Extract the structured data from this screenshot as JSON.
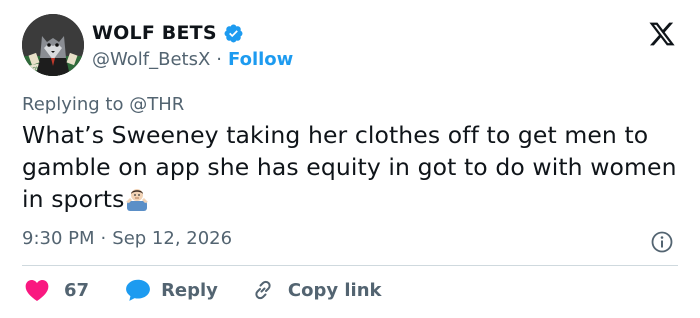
{
  "user": {
    "display_name": "WOLF BETS",
    "handle": "@Wolf_BetsX",
    "separator": "·",
    "follow_label": "Follow",
    "avatar_icon": "wolf-avatar",
    "verified_icon": "verified-badge-icon",
    "verified_color": "#1d9bf0"
  },
  "platform": {
    "logo_icon": "x-logo-icon"
  },
  "reply": {
    "prefix": "Replying to ",
    "target": "@THR"
  },
  "tweet": {
    "text": "What’s Sweeney taking her clothes off to get men to gamble on app she has equity in got to do with women in sports",
    "emoji": "man-shrugging-emoji"
  },
  "meta": {
    "time": "9:30 PM",
    "separator": "·",
    "date": "Sep 12, 2026",
    "info_icon": "info-icon"
  },
  "actions": {
    "like_icon": "heart-icon",
    "like_count": "67",
    "like_color": "#f91880",
    "reply_icon": "speech-bubble-icon",
    "reply_label": "Reply",
    "reply_color": "#1d9bf0",
    "copy_icon": "link-icon",
    "copy_label": "Copy link"
  },
  "colors": {
    "text": "#0f1419",
    "secondary": "#536471",
    "accent": "#1d9bf0",
    "divider": "#cfd9de"
  }
}
